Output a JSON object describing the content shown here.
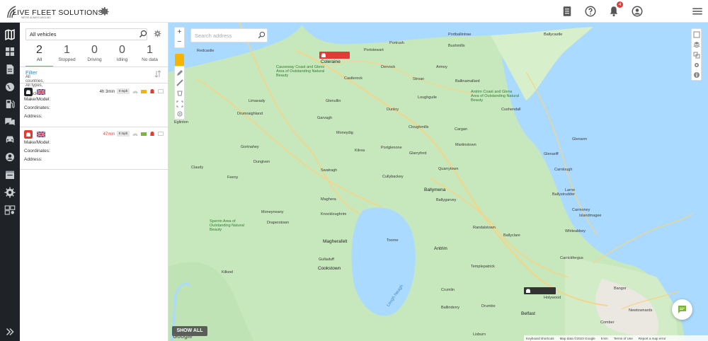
{
  "app": {
    "logo_title": "LIVE FLEET SOLUTIONS",
    "logo_subtitle": "WE'RE ALWAYS AROUND",
    "notification_count": "4"
  },
  "panel": {
    "search_value": "All vehicles",
    "counts": [
      {
        "num": "2",
        "label": "All"
      },
      {
        "num": "1",
        "label": "Stopped"
      },
      {
        "num": "0",
        "label": "Driving"
      },
      {
        "num": "0",
        "label": "Idling"
      },
      {
        "num": "1",
        "label": "No data"
      }
    ],
    "filter_title": "Filter",
    "filter_text": "All countries, All types, All vehicles"
  },
  "vehicles": [
    {
      "time": "4h 3min",
      "speed": "0 mph",
      "make": "Make/Model:",
      "coords": "Coordinates:",
      "address": "Address:",
      "icon_color": "#1f2327",
      "time_color": "#333333"
    },
    {
      "time": "47min",
      "speed": "0 mph",
      "make": "Make/Model:",
      "coords": "Coordinates:",
      "address": "Address:",
      "icon_color": "#e53935",
      "time_color": "#e53935"
    }
  ],
  "map": {
    "search_placeholder": "Search address",
    "show_all": "SHOW ALL",
    "google": "Google",
    "attribution": [
      "Keyboard shortcuts",
      "Map data ©2023 Google",
      "5 km",
      "Terms of Use",
      "Report a map error"
    ],
    "places": [
      "Redcastle",
      "Portstewart",
      "Portrush",
      "Portballintrae",
      "Bushmills",
      "Ballycastle",
      "Coleraine",
      "Dervock",
      "Armoy",
      "Ballinamallard",
      "Castlerock",
      "Causeway Coast and Glens Area of Outstanding Natural Beauty",
      "Stroan",
      "Cushendall",
      "Limavady",
      "Glenullin",
      "Loughguile",
      "Dunloy",
      "Antrim Coast and Glens Area of Outstanding Natural Beauty",
      "Drumraighland",
      "Garvagh",
      "Cloughmills",
      "Cargan",
      "Eglinton",
      "Moneydig",
      "Gortnahey",
      "Kilrea",
      "Portglenone",
      "Martinstown",
      "Dungiven",
      "Glarryford",
      "Claudy",
      "Feeny",
      "Swatragh",
      "Quarrytown",
      "Carnlough",
      "Glenariff",
      "Cullybackey",
      "Ballymena",
      "Ballystrudder",
      "Maghera",
      "Ballygarvey",
      "Knockloughrim",
      "Carmoney",
      "Magherafelt",
      "Randalstown",
      "Whiteabbey",
      "Draperstown",
      "Sperrin Area of Outstanding Natural Beauty",
      "Toome",
      "Antrim",
      "Moneyneany",
      "Gulladuff",
      "Templepatrick",
      "Kilkeel",
      "Cookstown",
      "Crumlin",
      "Holywood",
      "Bangor",
      "Belfast",
      "Lisburn",
      "Lough Neagh",
      "Ballinderry",
      "Drumbo",
      "Comber",
      "Newtownards",
      "Islandmagee",
      "Larne",
      "Glenarm",
      "Ballyclare",
      "Carrickfergus"
    ]
  },
  "colors": {
    "accent": "#7cb342",
    "nav_bg": "#1f2327",
    "link": "#1e88e5",
    "alert": "#e53935"
  }
}
